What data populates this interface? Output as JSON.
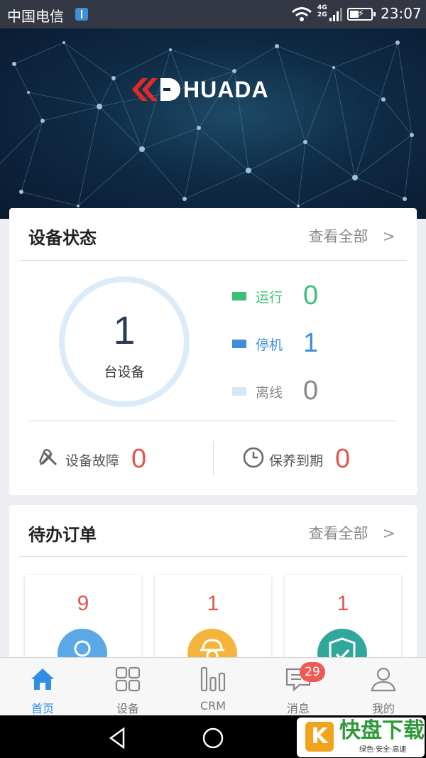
{
  "status_bar": {
    "carrier": "中国电信",
    "network": [
      "4G",
      "2G"
    ],
    "time": "23:07"
  },
  "banner": {
    "brand": "HUADA"
  },
  "device_status": {
    "title": "设备状态",
    "view_all": "查看全部",
    "total": {
      "value": "1",
      "label": "台设备"
    },
    "legend": [
      {
        "label": "运行",
        "value": "0",
        "color": "#3dbf7a"
      },
      {
        "label": "停机",
        "value": "1",
        "color": "#3e8fd8"
      },
      {
        "label": "离线",
        "value": "0",
        "color": "#d6e8f6"
      }
    ],
    "fault": {
      "label": "设备故障",
      "value": "0"
    },
    "maintenance": {
      "label": "保养到期",
      "value": "0"
    }
  },
  "pending_orders": {
    "title": "待办订单",
    "view_all": "查看全部",
    "items": [
      {
        "count": "9",
        "icon": "user-icon",
        "color": "#5aa9e6"
      },
      {
        "count": "1",
        "icon": "engineer-icon",
        "color": "#f5b53d"
      },
      {
        "count": "1",
        "icon": "shield-check-icon",
        "color": "#2fa79a"
      }
    ]
  },
  "tab_bar": {
    "tabs": [
      {
        "label": "首页",
        "icon": "home-icon",
        "active": true
      },
      {
        "label": "设备",
        "icon": "grid-icon"
      },
      {
        "label": "CRM",
        "icon": "bar-chart-icon"
      },
      {
        "label": "消息",
        "icon": "message-icon",
        "badge": "29"
      },
      {
        "label": "我的",
        "icon": "profile-icon"
      }
    ]
  },
  "watermark": {
    "logo": "K",
    "name": "快盘下载",
    "tagline": "绿色·安全·高速"
  },
  "colors": {
    "accent": "#2f8fe6",
    "alert": "#e0564d"
  }
}
